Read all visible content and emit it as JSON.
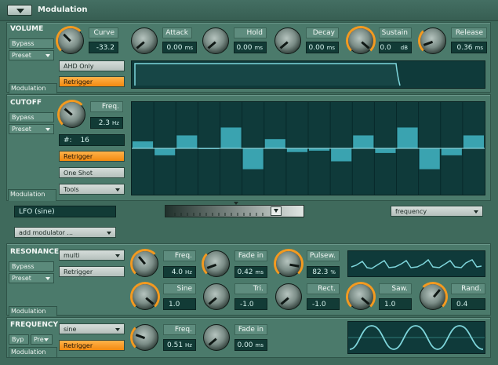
{
  "title": "Modulation",
  "volume": {
    "label": "VOLUME",
    "bypass": "Bypass",
    "preset": "Preset",
    "modulation_tab": "Modulation",
    "ahd_only": "AHD Only",
    "retrigger": "Retrigger",
    "knobs": [
      {
        "label": "Curve",
        "value": "-33.2",
        "unit": ""
      },
      {
        "label": "Attack",
        "value": "0.00",
        "unit": "ms"
      },
      {
        "label": "Hold",
        "value": "0.00",
        "unit": "ms"
      },
      {
        "label": "Decay",
        "value": "0.00",
        "unit": "ms"
      },
      {
        "label": "Sustain",
        "value": "0.0",
        "unit": "dB"
      },
      {
        "label": "Release",
        "value": "0.36",
        "unit": "ms"
      }
    ]
  },
  "cutoff": {
    "label": "CUTOFF",
    "bypass": "Bypass",
    "preset": "Preset",
    "modulation_tab": "Modulation",
    "freq_label": "Freq.",
    "freq_value": "2.3",
    "freq_unit": "Hz",
    "steps_label": "#:",
    "steps_value": "16",
    "retrigger": "Retrigger",
    "one_shot": "One Shot",
    "tools": "Tools",
    "step_values": [
      0.15,
      -0.15,
      0.28,
      0.0,
      0.45,
      -0.45,
      0.2,
      -0.08,
      -0.05,
      -0.28,
      0.28,
      -0.1,
      0.45,
      -0.45,
      -0.15,
      0.28
    ]
  },
  "lfo": {
    "name": "LFO (sine)",
    "target": "frequency",
    "add_modulator": "add modulator ..."
  },
  "resonance": {
    "label": "RESONANCE",
    "bypass": "Bypass",
    "preset": "Preset",
    "modulation_tab": "Modulation",
    "type": "multi",
    "retrigger": "Retrigger",
    "knobs": [
      {
        "label": "Freq.",
        "value": "4.0",
        "unit": "Hz"
      },
      {
        "label": "Fade in",
        "value": "0.42",
        "unit": "ms"
      },
      {
        "label": "Pulsew.",
        "value": "82.3",
        "unit": "%"
      },
      {
        "label": "Sine",
        "value": "1.0",
        "unit": ""
      },
      {
        "label": "Tri.",
        "value": "-1.0",
        "unit": ""
      },
      {
        "label": "Rect.",
        "value": "-1.0",
        "unit": ""
      },
      {
        "label": "Saw.",
        "value": "1.0",
        "unit": ""
      },
      {
        "label": "Rand.",
        "value": "0.4",
        "unit": ""
      }
    ]
  },
  "frequency": {
    "label": "FREQUENCY",
    "byp": "Byp",
    "pre": "Pre",
    "modulation_tab": "Modulation",
    "type": "sine",
    "retrigger": "Retrigger",
    "knobs": [
      {
        "label": "Freq.",
        "value": "0.51",
        "unit": "Hz"
      },
      {
        "label": "Fade in",
        "value": "0.00",
        "unit": "ms"
      }
    ]
  },
  "colors": {
    "accent": "#f39a20",
    "display_bg": "#0f3a3a",
    "display_line": "#7fd6dc"
  }
}
